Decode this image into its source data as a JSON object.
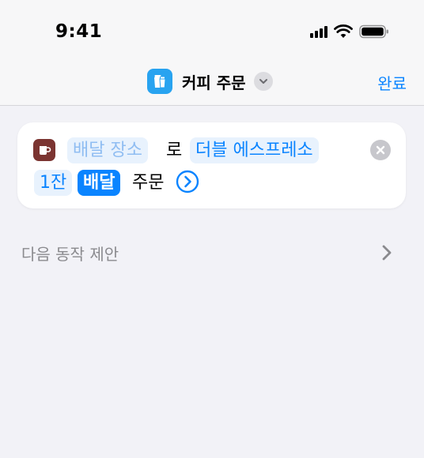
{
  "status_bar": {
    "time": "9:41"
  },
  "nav": {
    "title": "커피 주문",
    "done_label": "완료"
  },
  "action": {
    "location_placeholder": "배달 장소",
    "particle": "로",
    "drink": "더블 에스프레소",
    "quantity": "1잔",
    "method": "배달",
    "order_label": "주문"
  },
  "suggestions": {
    "label": "다음 동작 제안"
  },
  "colors": {
    "accent": "#0a84ff",
    "app_icon": "#28a3f0",
    "coffee_icon": "#7b3431",
    "background": "#f2f2f7"
  },
  "icons": {
    "app": "coffee-cup-icon",
    "action": "mug-icon",
    "more": "chevron-right-circle-icon",
    "remove": "close-circle-icon",
    "title_menu": "chevron-down-icon",
    "row_disclosure": "chevron-right-icon"
  }
}
